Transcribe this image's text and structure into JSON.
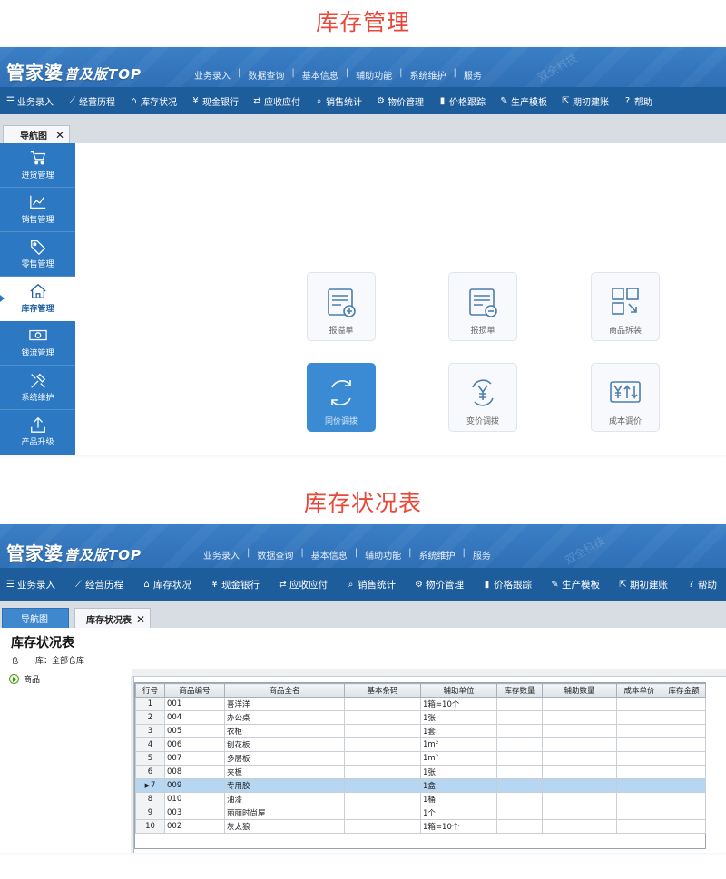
{
  "section1": {
    "caption": "库存管理",
    "app": {
      "logo_main": "管家婆",
      "logo_sub": "普及版TOP",
      "menu": [
        "业务录入",
        "数据查询",
        "基本信息",
        "辅助功能",
        "系统维护",
        "服务"
      ],
      "watermark": "双全科技"
    },
    "toolbar": [
      {
        "icon": "ledger-icon",
        "label": "业务录入"
      },
      {
        "icon": "trend-icon",
        "label": "经营历程"
      },
      {
        "icon": "house-icon",
        "label": "库存状况"
      },
      {
        "icon": "yen-icon",
        "label": "现金银行"
      },
      {
        "icon": "exchange-icon",
        "label": "应收应付"
      },
      {
        "icon": "search-icon",
        "label": "销售统计"
      },
      {
        "icon": "gear-icon",
        "label": "物价管理"
      },
      {
        "icon": "bar-chart-icon",
        "label": "价格跟踪"
      },
      {
        "icon": "wrench-icon",
        "label": "生产模板"
      },
      {
        "icon": "export-icon",
        "label": "期初建账"
      },
      {
        "icon": "help-icon",
        "label": "帮助"
      }
    ],
    "tab": {
      "label": "导航图",
      "close": "✕"
    },
    "sidebar": [
      {
        "icon": "cart-icon",
        "label": "进货管理"
      },
      {
        "icon": "line-chart-icon",
        "label": "销售管理"
      },
      {
        "icon": "tag-icon",
        "label": "零售管理"
      },
      {
        "icon": "house-icon",
        "label": "库存管理"
      },
      {
        "icon": "cash-icon",
        "label": "钱流管理"
      },
      {
        "icon": "tools-icon",
        "label": "系统维护"
      },
      {
        "icon": "upload-icon",
        "label": "产品升级"
      }
    ],
    "active_sidebar": "库存管理",
    "tiles": [
      {
        "icon": "document-add-icon",
        "label": "报溢单"
      },
      {
        "icon": "document-minus-icon",
        "label": "报损单"
      },
      {
        "icon": "grid-split-icon",
        "label": "商品拆装"
      },
      {
        "icon": "refresh-icon",
        "label": "同价调拨"
      },
      {
        "icon": "yen-cycle-icon",
        "label": "变价调拨"
      },
      {
        "icon": "yen-updown-icon",
        "label": "成本调价"
      }
    ]
  },
  "section2": {
    "caption": "库存状况表",
    "tabs": [
      {
        "label": "导航图"
      },
      {
        "label": "库存状况表",
        "close": "✕"
      }
    ],
    "report_title": "库存状况表",
    "warehouse": "仓　　库：全部仓库",
    "tree_root": "商品",
    "columns": [
      "行号",
      "商品编号",
      "商品全名",
      "基本条码",
      "辅助单位",
      "库存数量",
      "辅助数量",
      "成本单价",
      "库存金额"
    ],
    "rows": [
      [
        "1",
        "001",
        "喜洋洋",
        "",
        "1箱=10个",
        "",
        "",
        "",
        ""
      ],
      [
        "2",
        "004",
        "办公桌",
        "",
        "1张",
        "",
        "",
        "",
        ""
      ],
      [
        "3",
        "005",
        "衣柜",
        "",
        "1套",
        "",
        "",
        "",
        ""
      ],
      [
        "4",
        "006",
        "刨花板",
        "",
        "1m²",
        "",
        "",
        "",
        ""
      ],
      [
        "5",
        "007",
        "多层板",
        "",
        "1m²",
        "",
        "",
        "",
        ""
      ],
      [
        "6",
        "008",
        "夹板",
        "",
        "1张",
        "",
        "",
        "",
        ""
      ],
      [
        "7",
        "009",
        "专用胶",
        "",
        "1盒",
        "",
        "",
        "",
        ""
      ],
      [
        "8",
        "010",
        "油漆",
        "",
        "1桶",
        "",
        "",
        "",
        ""
      ],
      [
        "9",
        "003",
        "丽丽时尚屋",
        "",
        "1个",
        "",
        "",
        "",
        ""
      ],
      [
        "10",
        "002",
        "灰太狼",
        "",
        "1箱=10个",
        "",
        "",
        "",
        ""
      ]
    ],
    "selected_row": 7
  },
  "colors": {
    "accent_red": "#e8473a",
    "brand_blue": "#2f6fb5",
    "toolbar_blue": "#1e5d9c",
    "active_tile": "#3b8ad4"
  }
}
